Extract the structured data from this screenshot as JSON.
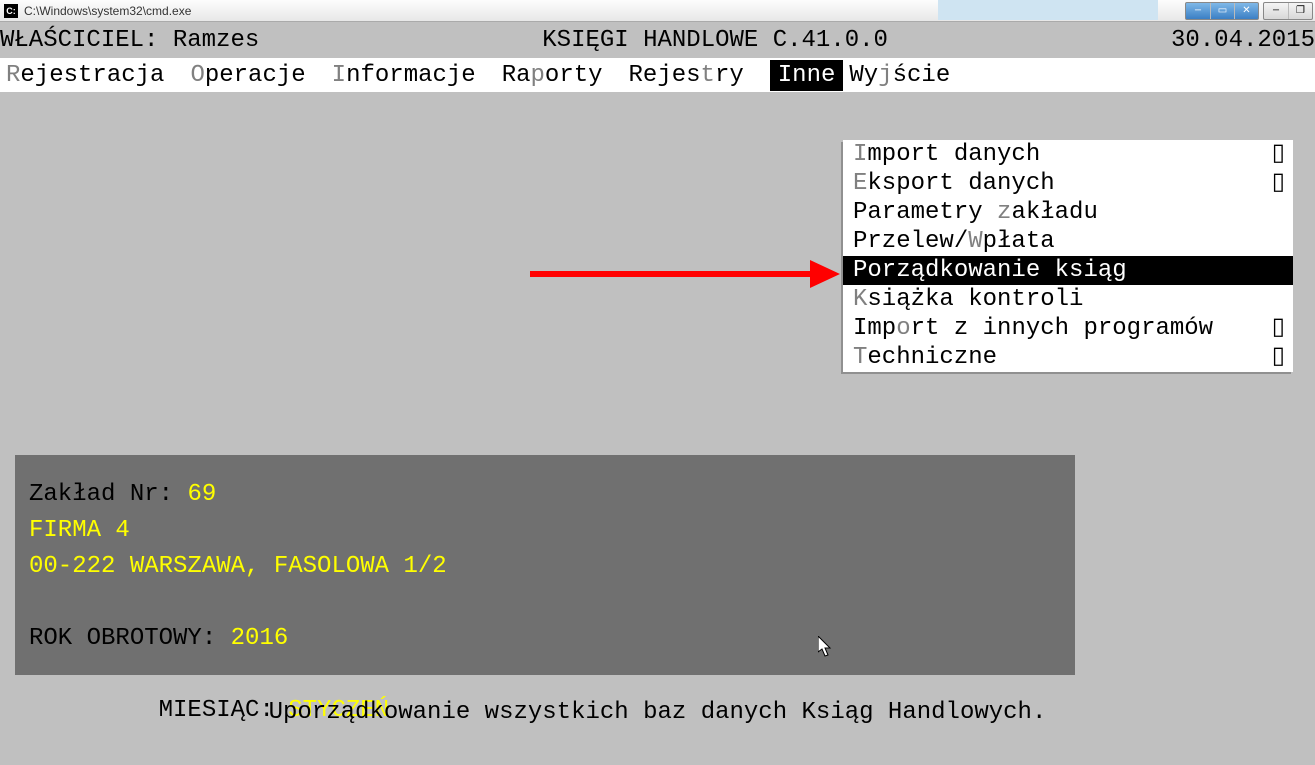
{
  "titlebar": {
    "path": "C:\\Windows\\system32\\cmd.exe"
  },
  "header": {
    "owner_label": "WŁAŚCICIEL: ",
    "owner_value": "Ramzes",
    "title": "KSIĘGI HANDLOWE C.41.0.0",
    "date": "30.04.2015"
  },
  "menu": {
    "items": [
      {
        "hot": "R",
        "rest": "ejestracja",
        "selected": false
      },
      {
        "hot": "O",
        "rest": "peracje",
        "selected": false
      },
      {
        "hot": "I",
        "rest": "nformacje",
        "selected": false
      },
      {
        "pre": "Ra",
        "hot": "p",
        "rest": "orty",
        "selected": false
      },
      {
        "pre": "Rejes",
        "hot": "t",
        "rest": "ry",
        "selected": false
      },
      {
        "hot": "I",
        "rest": "nne",
        "selected": true
      },
      {
        "pre": "Wy",
        "hot": "j",
        "rest": "ście",
        "selected": false
      }
    ]
  },
  "dropdown": {
    "items": [
      {
        "hot": "I",
        "rest": "mport danych",
        "selected": false,
        "submenu": true
      },
      {
        "hot": "E",
        "rest": "ksport danych",
        "selected": false,
        "submenu": true
      },
      {
        "pre": "Parametry ",
        "hot": "z",
        "rest": "akładu",
        "selected": false,
        "submenu": false
      },
      {
        "pre": "Przelew/",
        "hot": "W",
        "rest": "płata",
        "selected": false,
        "submenu": false
      },
      {
        "pre": "",
        "hot": "P",
        "rest": "orządkowanie ksiąg",
        "selected": true,
        "submenu": false
      },
      {
        "hot": "K",
        "rest": "siążka kontroli",
        "selected": false,
        "submenu": false
      },
      {
        "pre": "Imp",
        "hot": "o",
        "rest": "rt z innych programów",
        "selected": false,
        "submenu": true
      },
      {
        "hot": "T",
        "rest": "echniczne",
        "selected": false,
        "submenu": true
      }
    ]
  },
  "panel": {
    "zaklad_label": "Zakład Nr: ",
    "zaklad_value": "69",
    "firma": "FIRMA 4",
    "address": "00-222 WARSZAWA, FASOLOWA 1/2",
    "rok_label": "ROK OBROTOWY: ",
    "rok_value": "2016",
    "miesiac_label": "     MIESIĄC: ",
    "miesiac_value": "STYCZEŃ"
  },
  "hint": "Uporządkowanie wszystkich baz danych Ksiąg Handlowych.",
  "sub_ind": "▯"
}
